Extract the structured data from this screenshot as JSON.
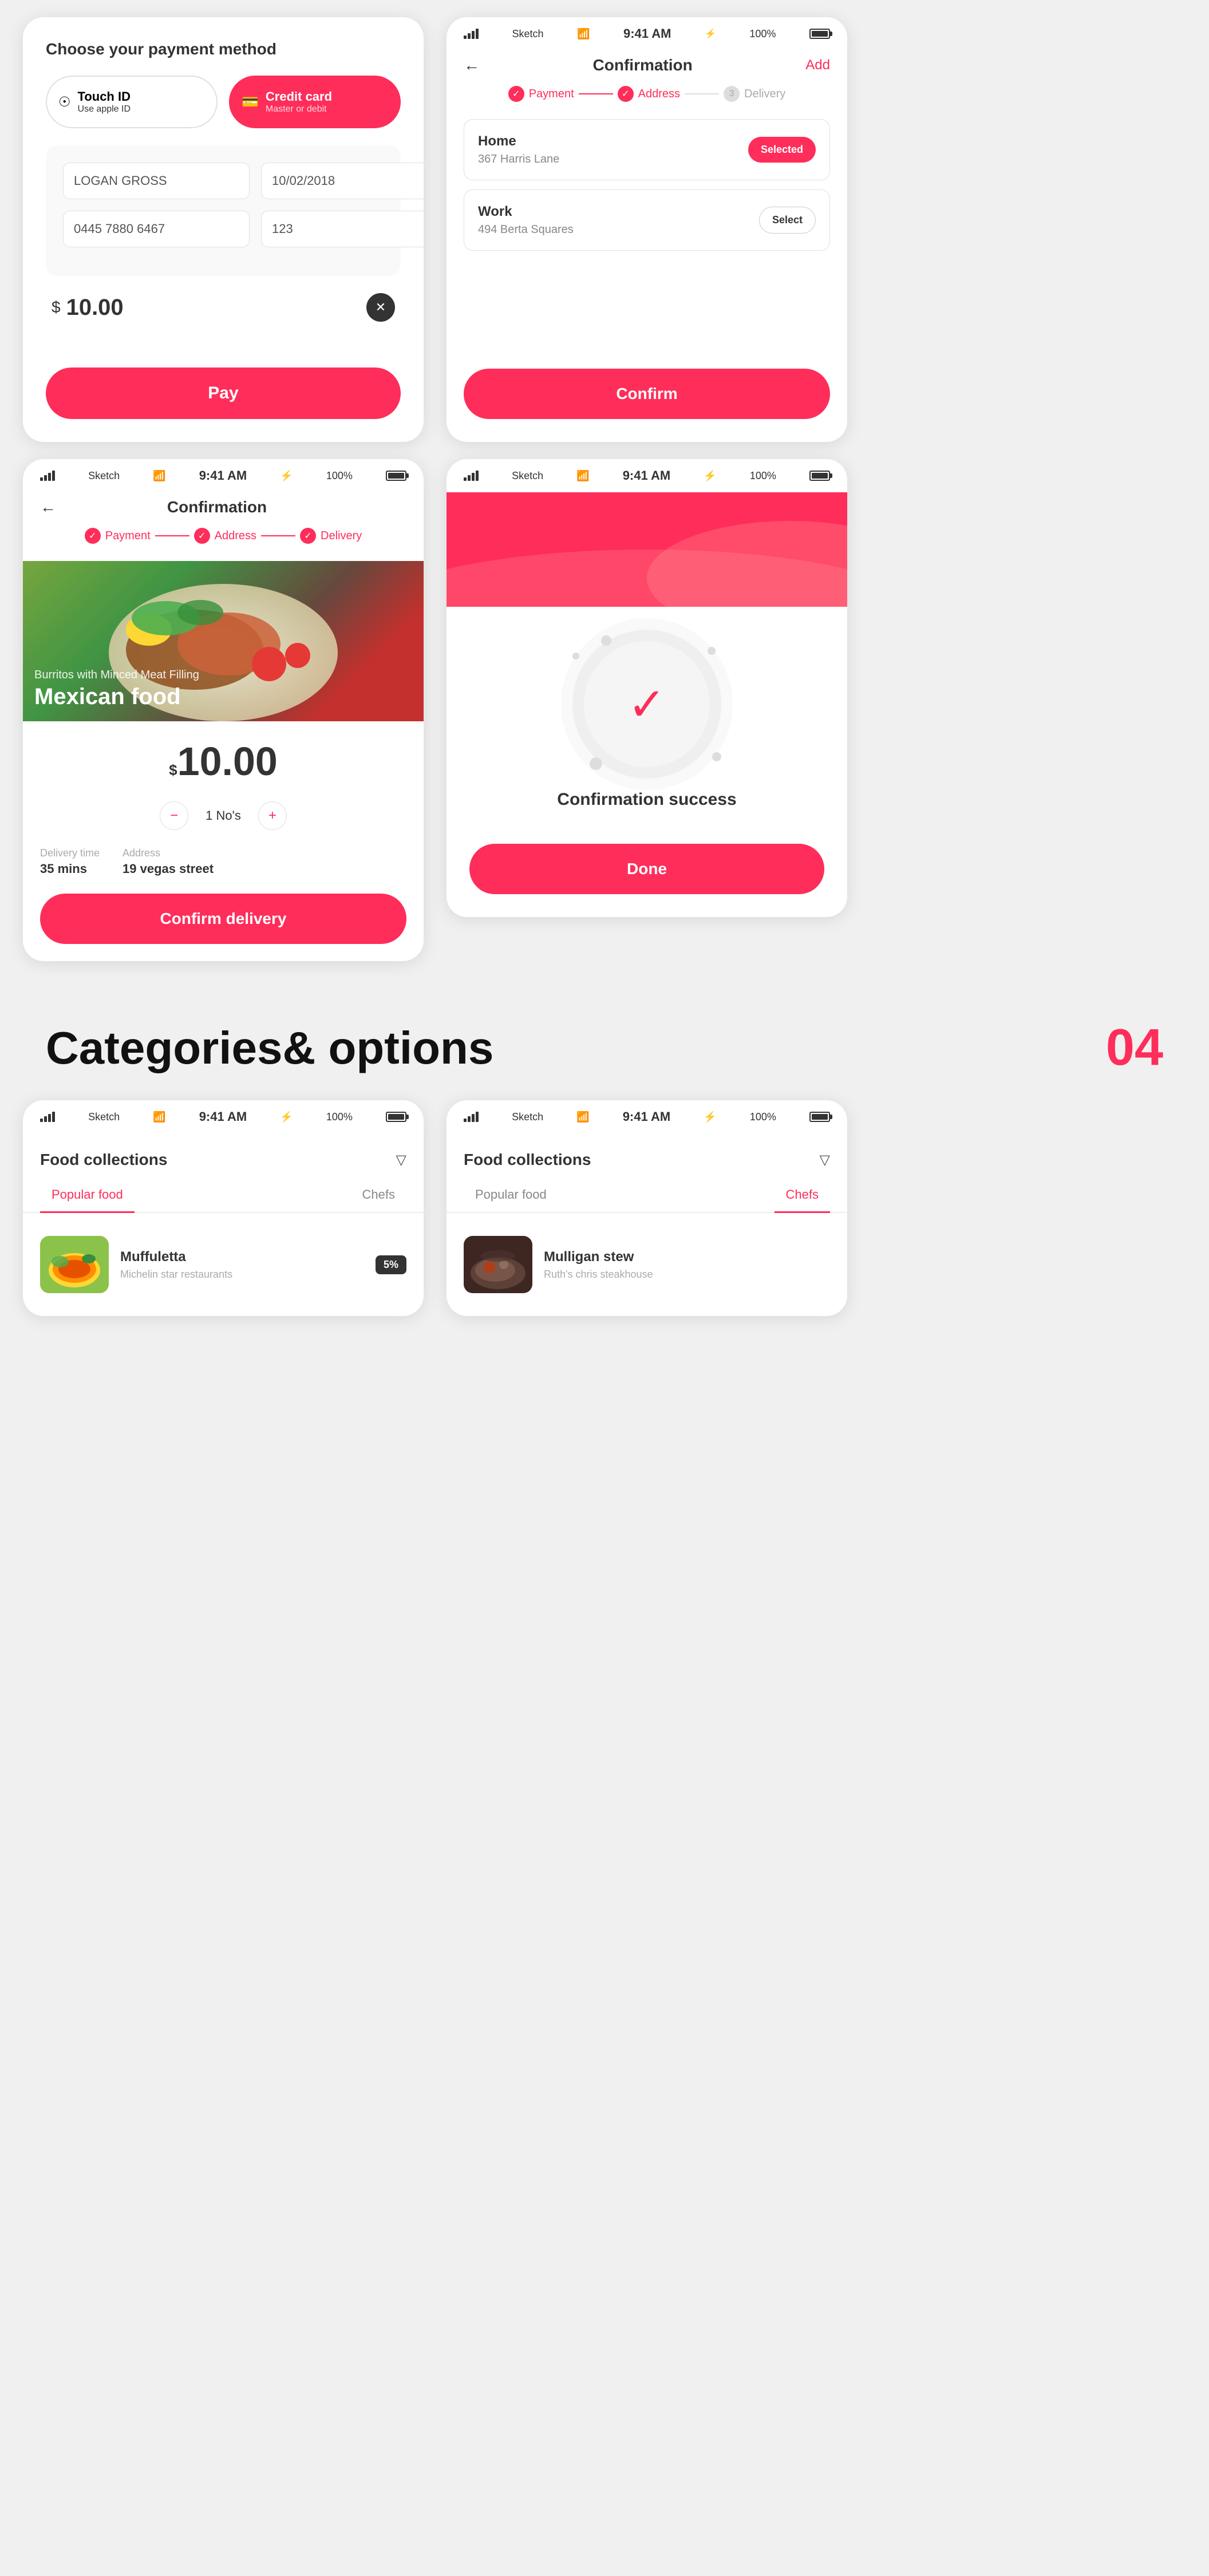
{
  "page": {
    "background": "#f0f0f0"
  },
  "top_left": {
    "title": "Choose your payment method",
    "touch_id_label": "Touch ID",
    "touch_id_sub": "Use apple ID",
    "credit_card_label": "Credit card",
    "credit_card_sub": "Master or debit",
    "cardholder_name": "LOGAN GROSS",
    "card_expiry": "10/02/2018",
    "card_number": "0445 7880 6467",
    "card_cvv": "123",
    "price_symbol": "$",
    "price_value": "10.00",
    "pay_button": "Pay"
  },
  "top_right": {
    "status_time": "9:41 AM",
    "battery": "100%",
    "nav_title": "Confirmation",
    "nav_action": "Add",
    "steps": [
      {
        "label": "Payment",
        "state": "done"
      },
      {
        "label": "Address",
        "state": "done"
      },
      {
        "label": "Delivery",
        "state": "pending"
      }
    ],
    "addresses": [
      {
        "label": "Home",
        "value": "367 Harris Lane",
        "action": "Selected",
        "active": true
      },
      {
        "label": "Work",
        "value": "494 Berta Squares",
        "action": "Select",
        "active": false
      }
    ],
    "confirm_button": "Confirm"
  },
  "middle_left": {
    "status_time": "9:41 AM",
    "nav_title": "Confirmation",
    "steps": [
      {
        "label": "Payment",
        "state": "done"
      },
      {
        "label": "Address",
        "state": "done"
      },
      {
        "label": "Delivery",
        "state": "done"
      }
    ],
    "food_subtitle": "Burritos with Minced Meat Filling",
    "food_title": "Mexican food",
    "price_symbol": "$",
    "price_value": "10.00",
    "quantity_minus": "−",
    "quantity_value": "1 No's",
    "quantity_plus": "+",
    "delivery_time_label": "Delivery time",
    "delivery_time_value": "35 mins",
    "address_label": "Address",
    "address_value": "19 vegas street",
    "confirm_delivery_button": "Confirm delivery"
  },
  "middle_right": {
    "status_time": "9:41 AM",
    "success_title": "Confirmation success",
    "done_button": "Done"
  },
  "section": {
    "title": "Categories& options",
    "number": "04"
  },
  "bottom_left": {
    "status_time": "9:41 AM",
    "collection_title": "Food collections",
    "tabs": [
      {
        "label": "Popular food",
        "active": true
      },
      {
        "label": "Chefs",
        "active": false
      }
    ],
    "items": [
      {
        "name": "Muffuletta",
        "sub": "Michelin star restaurants",
        "badge": "5%"
      }
    ]
  },
  "bottom_right": {
    "status_time": "9:41 AM",
    "collection_title": "Food collections",
    "tabs": [
      {
        "label": "Popular food",
        "active": false
      },
      {
        "label": "Chefs",
        "active": true
      }
    ],
    "items": [
      {
        "name": "Mulligan stew",
        "sub": "Ruth's chris steakhouse"
      }
    ]
  }
}
